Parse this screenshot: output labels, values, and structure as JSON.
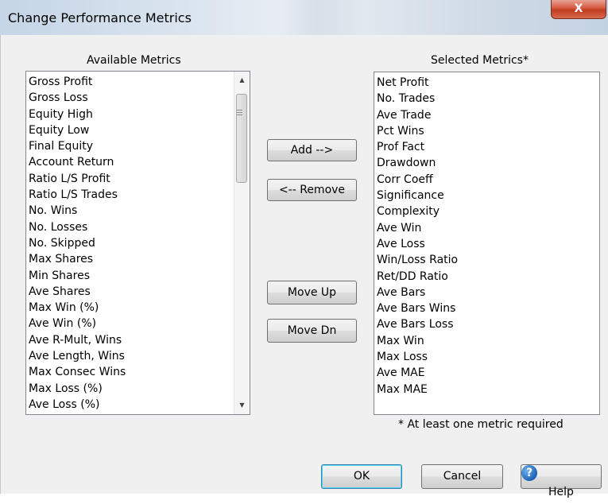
{
  "window": {
    "title": "Change Performance Metrics",
    "close_glyph": "X"
  },
  "available": {
    "label": "Available Metrics",
    "items": [
      "Gross Profit",
      "Gross Loss",
      "Equity High",
      "Equity Low",
      "Final Equity",
      "Account Return",
      "Ratio L/S Profit",
      "Ratio L/S Trades",
      "No. Wins",
      "No. Losses",
      "No. Skipped",
      "Max Shares",
      "Min Shares",
      "Ave Shares",
      "Max Win (%)",
      "Ave Win (%)",
      "Ave R-Mult, Wins",
      "Ave Length, Wins",
      "Max Consec Wins",
      "Max Loss (%)",
      "Ave Loss (%)"
    ]
  },
  "selected": {
    "label": "Selected Metrics*",
    "items": [
      "Net Profit",
      "No. Trades",
      "Ave Trade",
      "Pct Wins",
      "Prof Fact",
      "Drawdown",
      "Corr Coeff",
      "Significance",
      "Complexity",
      "Ave Win",
      "Ave Loss",
      "Win/Loss Ratio",
      "Ret/DD Ratio",
      "Ave Bars",
      "Ave Bars Wins",
      "Ave Bars Loss",
      "Max Win",
      "Max Loss",
      "Ave MAE",
      "Max MAE"
    ]
  },
  "actions": {
    "add": "Add -->",
    "remove": "<-- Remove",
    "move_up": "Move Up",
    "move_down": "Move Dn"
  },
  "footnote": "* At least one metric required",
  "buttons": {
    "ok": "OK",
    "cancel": "Cancel",
    "help": "Help",
    "help_icon": "?"
  },
  "icons": {
    "scroll_up": "scroll-up-arrow-icon",
    "scroll_down": "scroll-down-arrow-icon",
    "help": "help-question-icon"
  }
}
